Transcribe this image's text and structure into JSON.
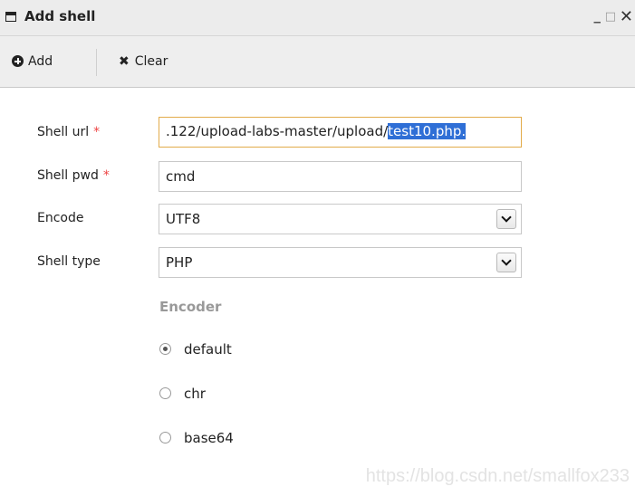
{
  "window": {
    "title": "Add shell",
    "controls": {
      "minimize": "_",
      "maximize": "□",
      "close": "✕"
    }
  },
  "toolbar": {
    "add_label": "Add",
    "clear_label": "Clear"
  },
  "form": {
    "shell_url": {
      "label": "Shell url",
      "required_mark": "*",
      "value_prefix": ".122/upload-labs-master/upload/",
      "value_selected": "test10.php."
    },
    "shell_pwd": {
      "label": "Shell pwd",
      "required_mark": "*",
      "value": "cmd"
    },
    "encode": {
      "label": "Encode",
      "value": "UTF8"
    },
    "shell_type": {
      "label": "Shell type",
      "value": "PHP"
    },
    "encoder": {
      "label": "Encoder",
      "options": [
        {
          "label": "default",
          "checked": true
        },
        {
          "label": "chr",
          "checked": false
        },
        {
          "label": "base64",
          "checked": false
        }
      ]
    }
  },
  "watermark": "https://blog.csdn.net/smallfox233",
  "colors": {
    "focus_border": "#e2ab4a",
    "selection": "#2f6fd6",
    "required": "#e44444"
  }
}
